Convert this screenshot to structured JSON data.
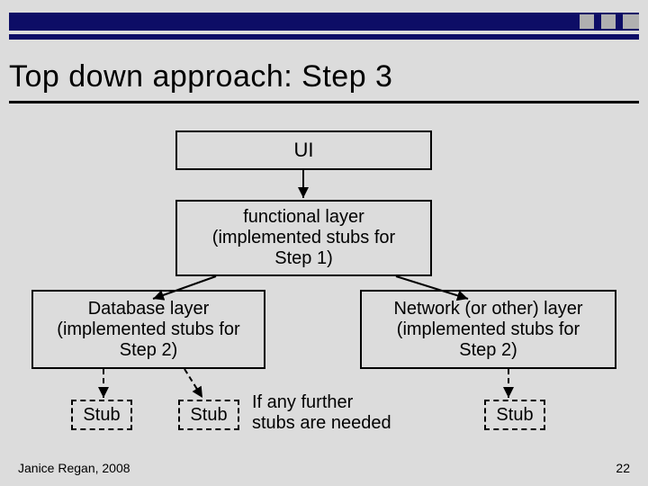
{
  "title": "Top down approach:  Step 3",
  "boxes": {
    "ui": "UI",
    "functional": "functional layer\n(implemented stubs for\nStep 1)",
    "database": "Database layer\n(implemented stubs for\nStep 2)",
    "network": "Network (or other)  layer\n(implemented stubs for\nStep 2)",
    "stub1": "Stub",
    "stub2": "Stub",
    "stub3": "Stub"
  },
  "note": "If any further\nstubs are needed",
  "footer": {
    "author": "Janice Regan, 2008",
    "page": "22"
  }
}
